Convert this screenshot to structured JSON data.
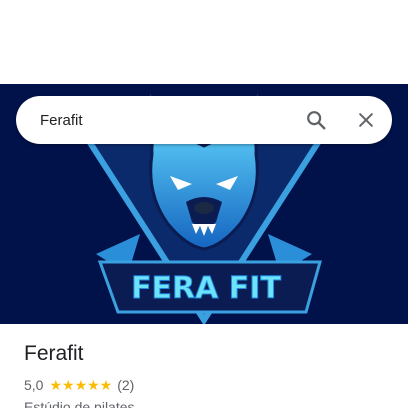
{
  "search": {
    "value": "Ferafit"
  },
  "hero": {
    "logo_text": "FERA FIT"
  },
  "place": {
    "name": "Ferafit",
    "rating": "5,0",
    "stars": "★★★★★",
    "review_count": "(2)",
    "category": "Estúdio de pilates"
  },
  "colors": {
    "hero_bg": "#01114a",
    "star": "#fbbc04",
    "accent": "#4fc3f7"
  },
  "icons": {
    "search": "search-icon",
    "close": "close-icon"
  }
}
